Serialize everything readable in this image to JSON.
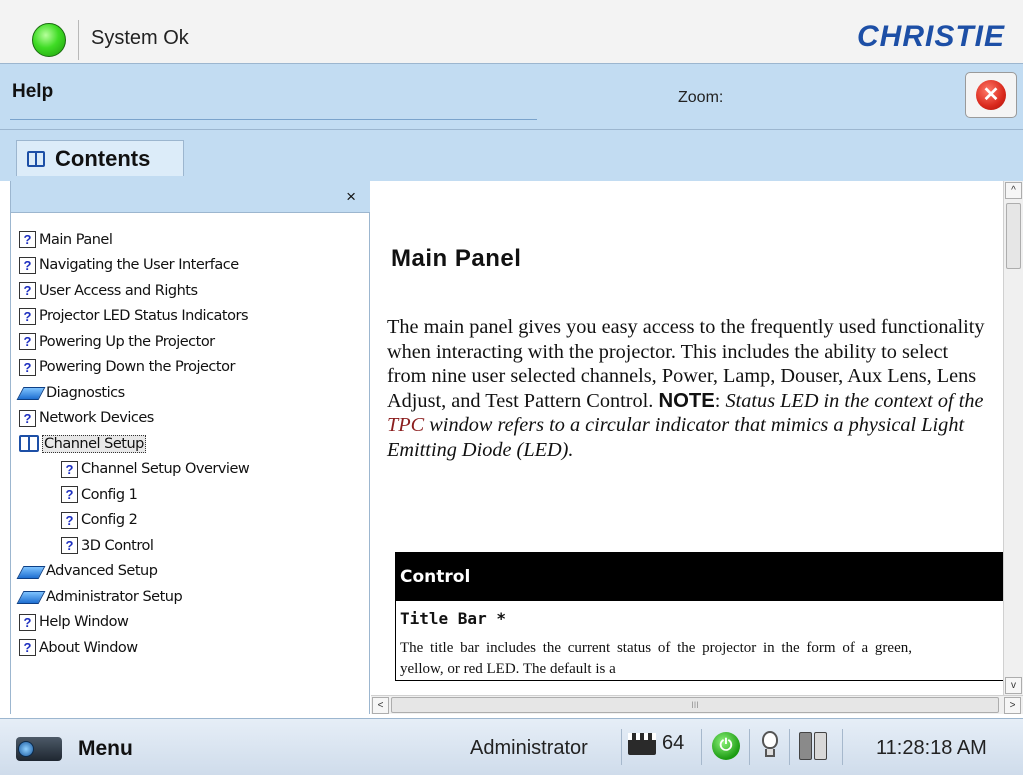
{
  "status": {
    "text": "System Ok",
    "led_color": "#3fdc25"
  },
  "brand": {
    "name": "CHRISTIE"
  },
  "help": {
    "title": "Help",
    "zoom_label": "Zoom:"
  },
  "tabs": {
    "contents_label": "Contents"
  },
  "toc": {
    "close_symbol": "×",
    "items": [
      {
        "label": "Main Panel",
        "icon": "help-page-icon",
        "level": 0
      },
      {
        "label": "Navigating the User Interface",
        "icon": "help-page-icon",
        "level": 0
      },
      {
        "label": "User Access and Rights",
        "icon": "help-page-icon",
        "level": 0
      },
      {
        "label": "Projector LED Status Indicators",
        "icon": "help-page-icon",
        "level": 0
      },
      {
        "label": "Powering Up the Projector",
        "icon": "help-page-icon",
        "level": 0
      },
      {
        "label": "Powering Down the Projector",
        "icon": "help-page-icon",
        "level": 0
      },
      {
        "label": "Diagnostics",
        "icon": "book-closed-icon",
        "level": 0
      },
      {
        "label": "Network Devices",
        "icon": "help-page-icon",
        "level": 0
      },
      {
        "label": "Channel Setup",
        "icon": "book-open-icon",
        "level": 0,
        "selected": true
      },
      {
        "label": "Channel Setup Overview",
        "icon": "help-page-icon",
        "level": 1
      },
      {
        "label": "Config 1",
        "icon": "help-page-icon",
        "level": 1
      },
      {
        "label": "Config 2",
        "icon": "help-page-icon",
        "level": 1
      },
      {
        "label": "3D Control",
        "icon": "help-page-icon",
        "level": 1
      },
      {
        "label": "Advanced Setup",
        "icon": "book-closed-icon",
        "level": 0
      },
      {
        "label": "Administrator Setup",
        "icon": "book-closed-icon",
        "level": 0
      },
      {
        "label": "Help Window",
        "icon": "help-page-icon",
        "level": 0
      },
      {
        "label": "About Window",
        "icon": "help-page-icon",
        "level": 0
      }
    ]
  },
  "doc": {
    "title": "Main Panel",
    "para_text": "The main panel gives you easy access to the frequently used functionality when interacting with the projector. This includes the ability to select from nine user selected channels, Power, Lamp, Douser, Aux Lens, Lens Adjust, and Test Pattern Control.",
    "note_label": "NOTE",
    "note_colon": ":",
    "note_pre": "Status LED in the context of the",
    "note_tpc": "TPC",
    "note_post": "window refers to a circular indicator that mimics a physical Light Emitting Diode (LED).",
    "table": {
      "header": "Control",
      "row_title": "Title Bar *",
      "row_desc": "The title bar includes the current status of the projector in the form of a green, yellow, or red LED. The default is a"
    }
  },
  "scroll": {
    "up": "^",
    "down": "v",
    "left": "<",
    "right": ">",
    "grip": "III"
  },
  "bottombar": {
    "menu_label": "Menu",
    "user_role": "Administrator",
    "channel_number": "64",
    "power_symbol": "⏻",
    "clock": "11:28:18 AM"
  }
}
